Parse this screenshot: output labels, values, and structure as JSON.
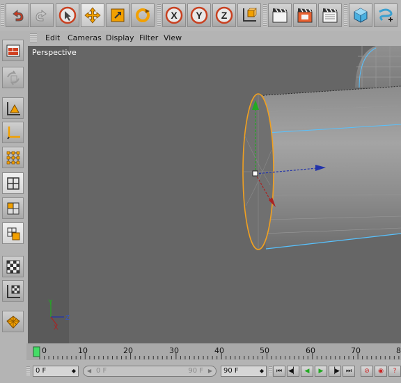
{
  "menu": {
    "items": [
      "Edit",
      "Cameras",
      "Display",
      "Filter",
      "View"
    ]
  },
  "viewport": {
    "label": "Perspective",
    "axis": {
      "x": "X",
      "y": "Y",
      "z": "Z"
    }
  },
  "toolbar": {
    "axis_x": "X",
    "axis_y": "Y",
    "axis_z": "Z",
    "icons": [
      "undo-icon",
      "redo-icon",
      "live-selection-icon",
      "move-icon",
      "scale-icon",
      "rotate-icon",
      "lock-x-icon",
      "lock-y-icon",
      "lock-z-icon",
      "coordinate-system-icon",
      "render-view-icon",
      "render-picture-viewer-icon",
      "render-settings-icon",
      "cube-primitive-icon",
      "spline-pen-icon"
    ]
  },
  "left_toolbar": {
    "icons": [
      "make-editable-icon",
      "model-mode-icon",
      "object-axis-icon",
      "axis-mode-icon",
      "points-mode-icon",
      "edges-mode-icon",
      "polygons-mode-icon",
      "uvw-mode-icon",
      "texture-mode-icon",
      "workplane-icon",
      "snapping-icon"
    ]
  },
  "timeline": {
    "ticks": [
      "0",
      "10",
      "20",
      "30",
      "40",
      "50",
      "60",
      "70",
      "8"
    ],
    "current_frame": 0
  },
  "playback": {
    "start_frame": "0 F",
    "range_start": "0 F",
    "range_end": "90 F",
    "end_frame": "90 F",
    "buttons": [
      "goto-start-icon",
      "prev-keyframe-icon",
      "play-backward-icon",
      "play-forward-icon",
      "next-keyframe-icon",
      "goto-end-icon",
      "record-icon",
      "autokey-icon",
      "keyframe-selection-icon"
    ]
  },
  "colors": {
    "viewport": "#666666",
    "selection": "#f0a020",
    "highlight": "#57c2ff"
  }
}
